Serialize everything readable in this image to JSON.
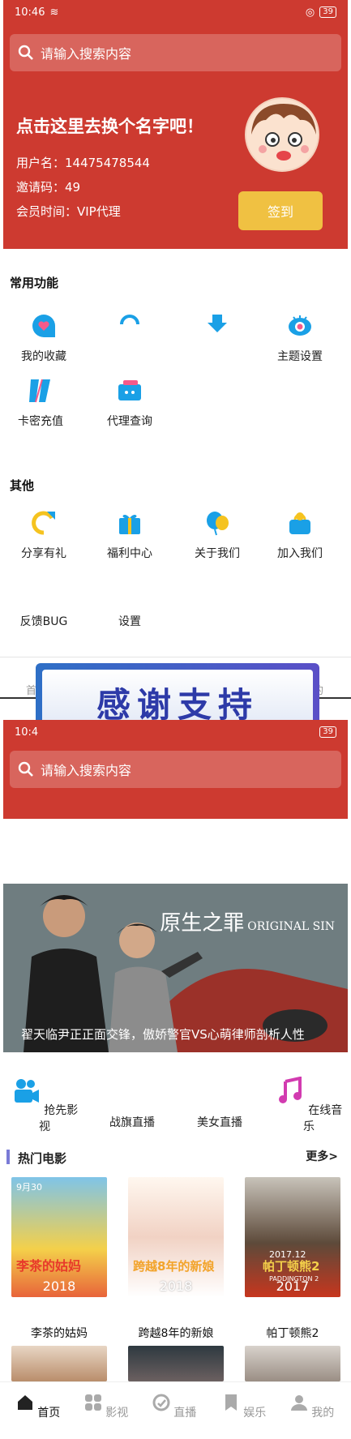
{
  "status": {
    "time": "10:46",
    "battery": "39"
  },
  "search": {
    "placeholder": "请输入搜索内容"
  },
  "profile": {
    "nickname": "点击这里去换个名字吧！",
    "username": "用户名：14475478544",
    "invite": "邀请码：49",
    "member": "会员时间：VIP代理",
    "sign_button": "签到"
  },
  "common": {
    "title": "常用功能",
    "items": [
      "我的收藏",
      "主题设置",
      "卡密充值",
      "代理查询"
    ]
  },
  "other": {
    "title": "其他",
    "items": [
      "分享有礼",
      "福利中心",
      "关于我们",
      "加入我们",
      "反馈BUG",
      "设置"
    ]
  },
  "tabbar1": {
    "left": "首",
    "right": "的"
  },
  "banner": {
    "text": "感谢支持"
  },
  "status2": {
    "time": "10:4",
    "battery": "39"
  },
  "hero": {
    "caption": "翟天临尹正正面交锋，傲娇警官VS心萌律师剖析人性",
    "logo": "原生之罪",
    "logo_en": "ORIGINAL SIN"
  },
  "categories": [
    "抢先影视",
    "战旗直播",
    "美女直播",
    "在线音乐"
  ],
  "hot": {
    "title": "热门电影",
    "more": "更多>"
  },
  "movies": [
    {
      "title": "李茶的姑妈",
      "year": "2018",
      "poster_label": "李茶的姑妈",
      "date": "9月30"
    },
    {
      "title": "跨越8年的新娘",
      "year": "2018",
      "poster_label": "跨越8年的新娘"
    },
    {
      "title": "帕丁顿熊2",
      "year": "2017",
      "poster_label": "帕丁顿熊2",
      "en": "PADDINGTON 2",
      "date": "2017.12"
    }
  ],
  "tabs": [
    "首页",
    "影视",
    "直播",
    "娱乐",
    "我的"
  ],
  "colors": {
    "brand_red": "#cd3a30",
    "sign_yellow": "#f0c142",
    "icon_blue": "#1aa0e6",
    "music_pink": "#d23bb0"
  }
}
